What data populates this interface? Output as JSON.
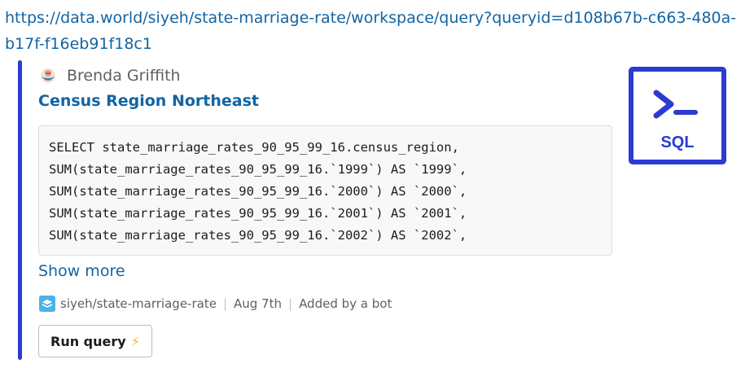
{
  "message": {
    "url": "https://data.world/siyeh/state-marriage-rate/workspace/query?queryid=d108b67b-c663-480a-b17f-f16eb91f18c1"
  },
  "card": {
    "author": "Brenda Griffith",
    "title": "Census Region Northeast",
    "code_lines": [
      "SELECT state_marriage_rates_90_95_99_16.census_region,",
      "SUM(state_marriage_rates_90_95_99_16.`1999`) AS `1999`,",
      "SUM(state_marriage_rates_90_95_99_16.`2000`) AS `2000`,",
      "SUM(state_marriage_rates_90_95_99_16.`2001`) AS `2001`,",
      "SUM(state_marriage_rates_90_95_99_16.`2002`) AS `2002`,"
    ],
    "show_more": "Show more",
    "dataset": "siyeh/state-marriage-rate",
    "date": "Aug 7th",
    "added_by": "Added by a bot",
    "run_button": "Run query",
    "run_icon": "⚡",
    "sql_icon_label": "SQL",
    "accent_color": "#2b3bd1",
    "link_color": "#1264a3"
  }
}
